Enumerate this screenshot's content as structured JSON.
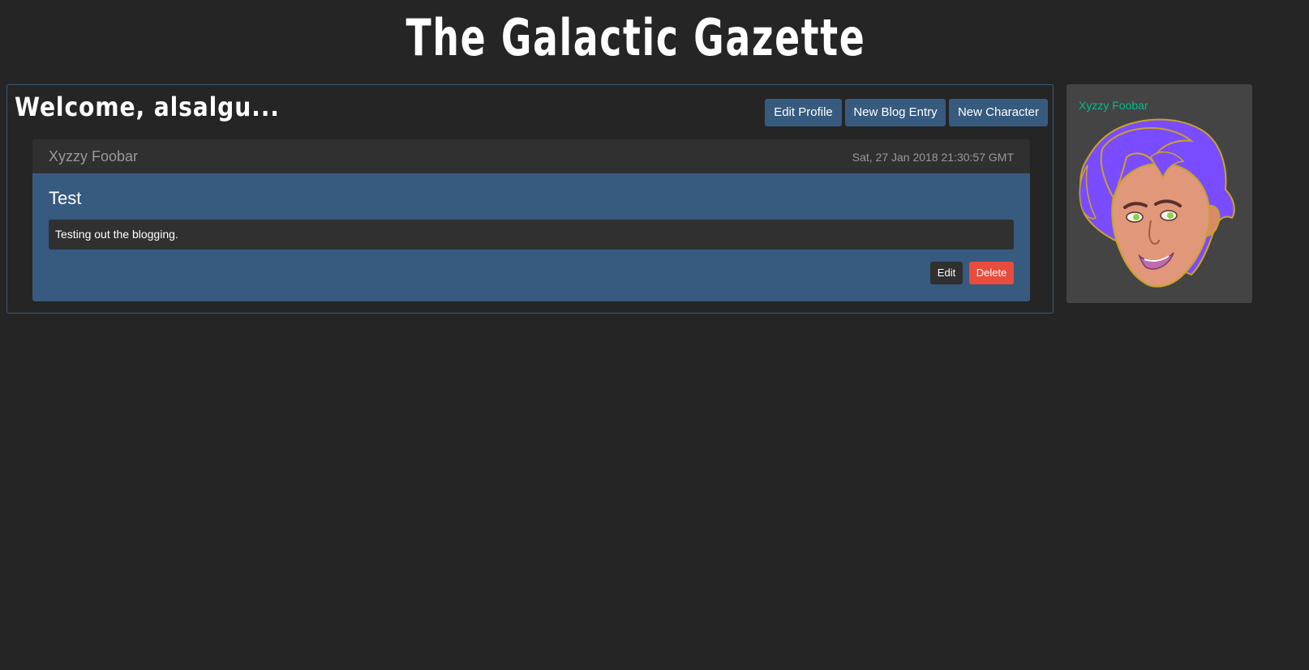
{
  "site": {
    "title": "The Galactic Gazette"
  },
  "profile": {
    "welcome": "Welcome, alsalgu...",
    "buttons": {
      "edit_profile": "Edit Profile",
      "new_blog_entry": "New Blog Entry",
      "new_character": "New Character"
    }
  },
  "post": {
    "author": "Xyzzy Foobar",
    "date": "Sat, 27 Jan 2018 21:30:57 GMT",
    "title": "Test",
    "body": "Testing out the blogging.",
    "edit_label": "Edit",
    "delete_label": "Delete"
  },
  "character": {
    "name": "Xyzzy Foobar",
    "portrait_icon": "character-portrait"
  },
  "colors": {
    "background": "#252525",
    "primary": "#375a7f",
    "danger": "#e74c3c",
    "success": "#00bc8c",
    "card_header": "#303030",
    "side_card": "#444444"
  }
}
